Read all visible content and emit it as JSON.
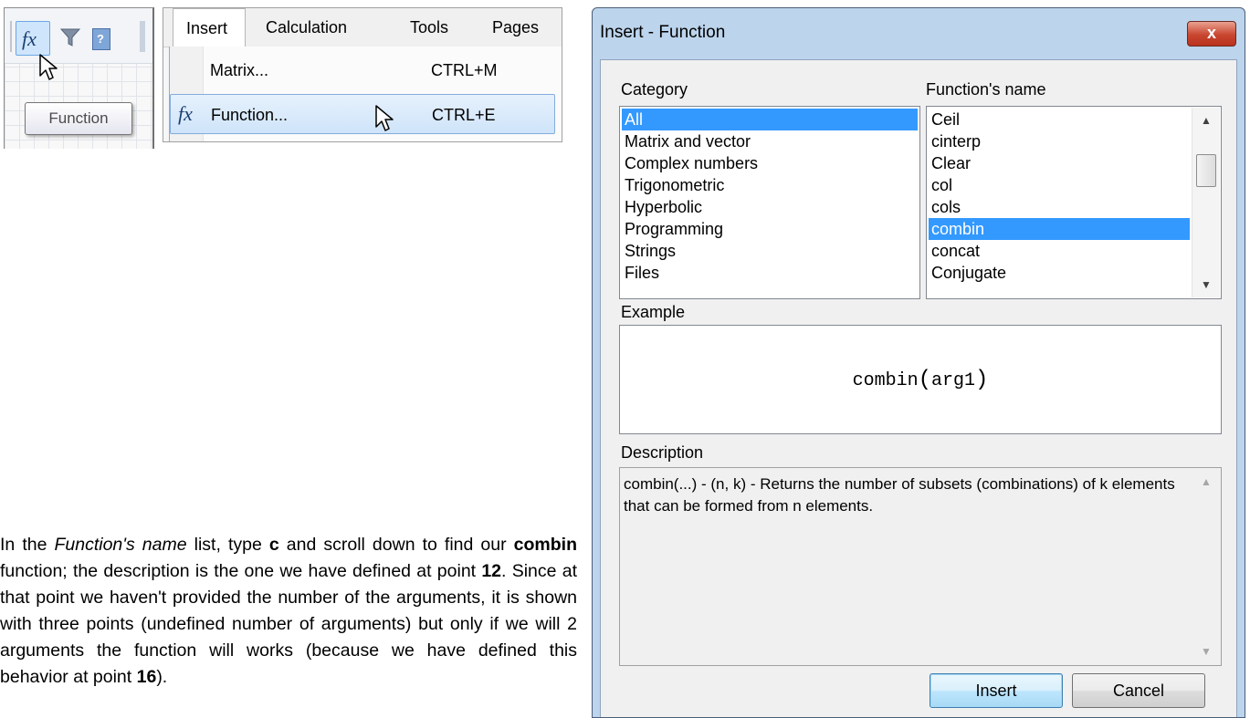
{
  "toolbar_crop": {
    "fx_icon": "fx",
    "filter_icon": "funnel-icon",
    "help_icon": "?",
    "tooltip": "Function"
  },
  "menu_crop": {
    "tabs": [
      "Insert",
      "Calculation",
      "Tools",
      "Pages"
    ],
    "items": [
      {
        "icon": "",
        "label": "Matrix...",
        "shortcut": "CTRL+M"
      },
      {
        "icon": "fx",
        "label": "Function...",
        "shortcut": "CTRL+E"
      }
    ]
  },
  "paragraph": {
    "t1": "In the ",
    "t2": "Function's name",
    "t3": " list, type ",
    "t4": "c",
    "t5": " and scroll down to find our ",
    "t6": "combin",
    "t7": " function; the description is the one we have defined at point ",
    "t8": "12",
    "t9": ". Since at that point we haven't provided the number of the arguments, it is shown with three points (undefined number of arguments) but only if we will 2 arguments the function will works (because we have defined this behavior at point ",
    "t10": "16",
    "t11": ")."
  },
  "dialog": {
    "title": "Insert - Function",
    "close_label": "x",
    "category_label": "Category",
    "categories": [
      "All",
      "Matrix and vector",
      "Complex numbers",
      "Trigonometric",
      "Hyperbolic",
      "Programming",
      "Strings",
      "Files"
    ],
    "selected_category": "All",
    "function_label": "Function's name",
    "functions": [
      "Ceil",
      "cinterp",
      "Clear",
      "col",
      "cols",
      "combin",
      "concat",
      "Conjugate"
    ],
    "selected_function": "combin",
    "example_label": "Example",
    "example": {
      "name": "combin",
      "open": "(",
      "arg": "arg1",
      "close": ")"
    },
    "description_label": "Description",
    "description": "combin(...) - (n, k) - Returns the number of subsets (combinations) of k elements that can be formed from n elements.",
    "insert_button": "Insert",
    "cancel_button": "Cancel"
  },
  "colors": {
    "selection": "#3399ff",
    "dialog_frame": "#bcd4ec",
    "close_button": "#c9462f"
  }
}
